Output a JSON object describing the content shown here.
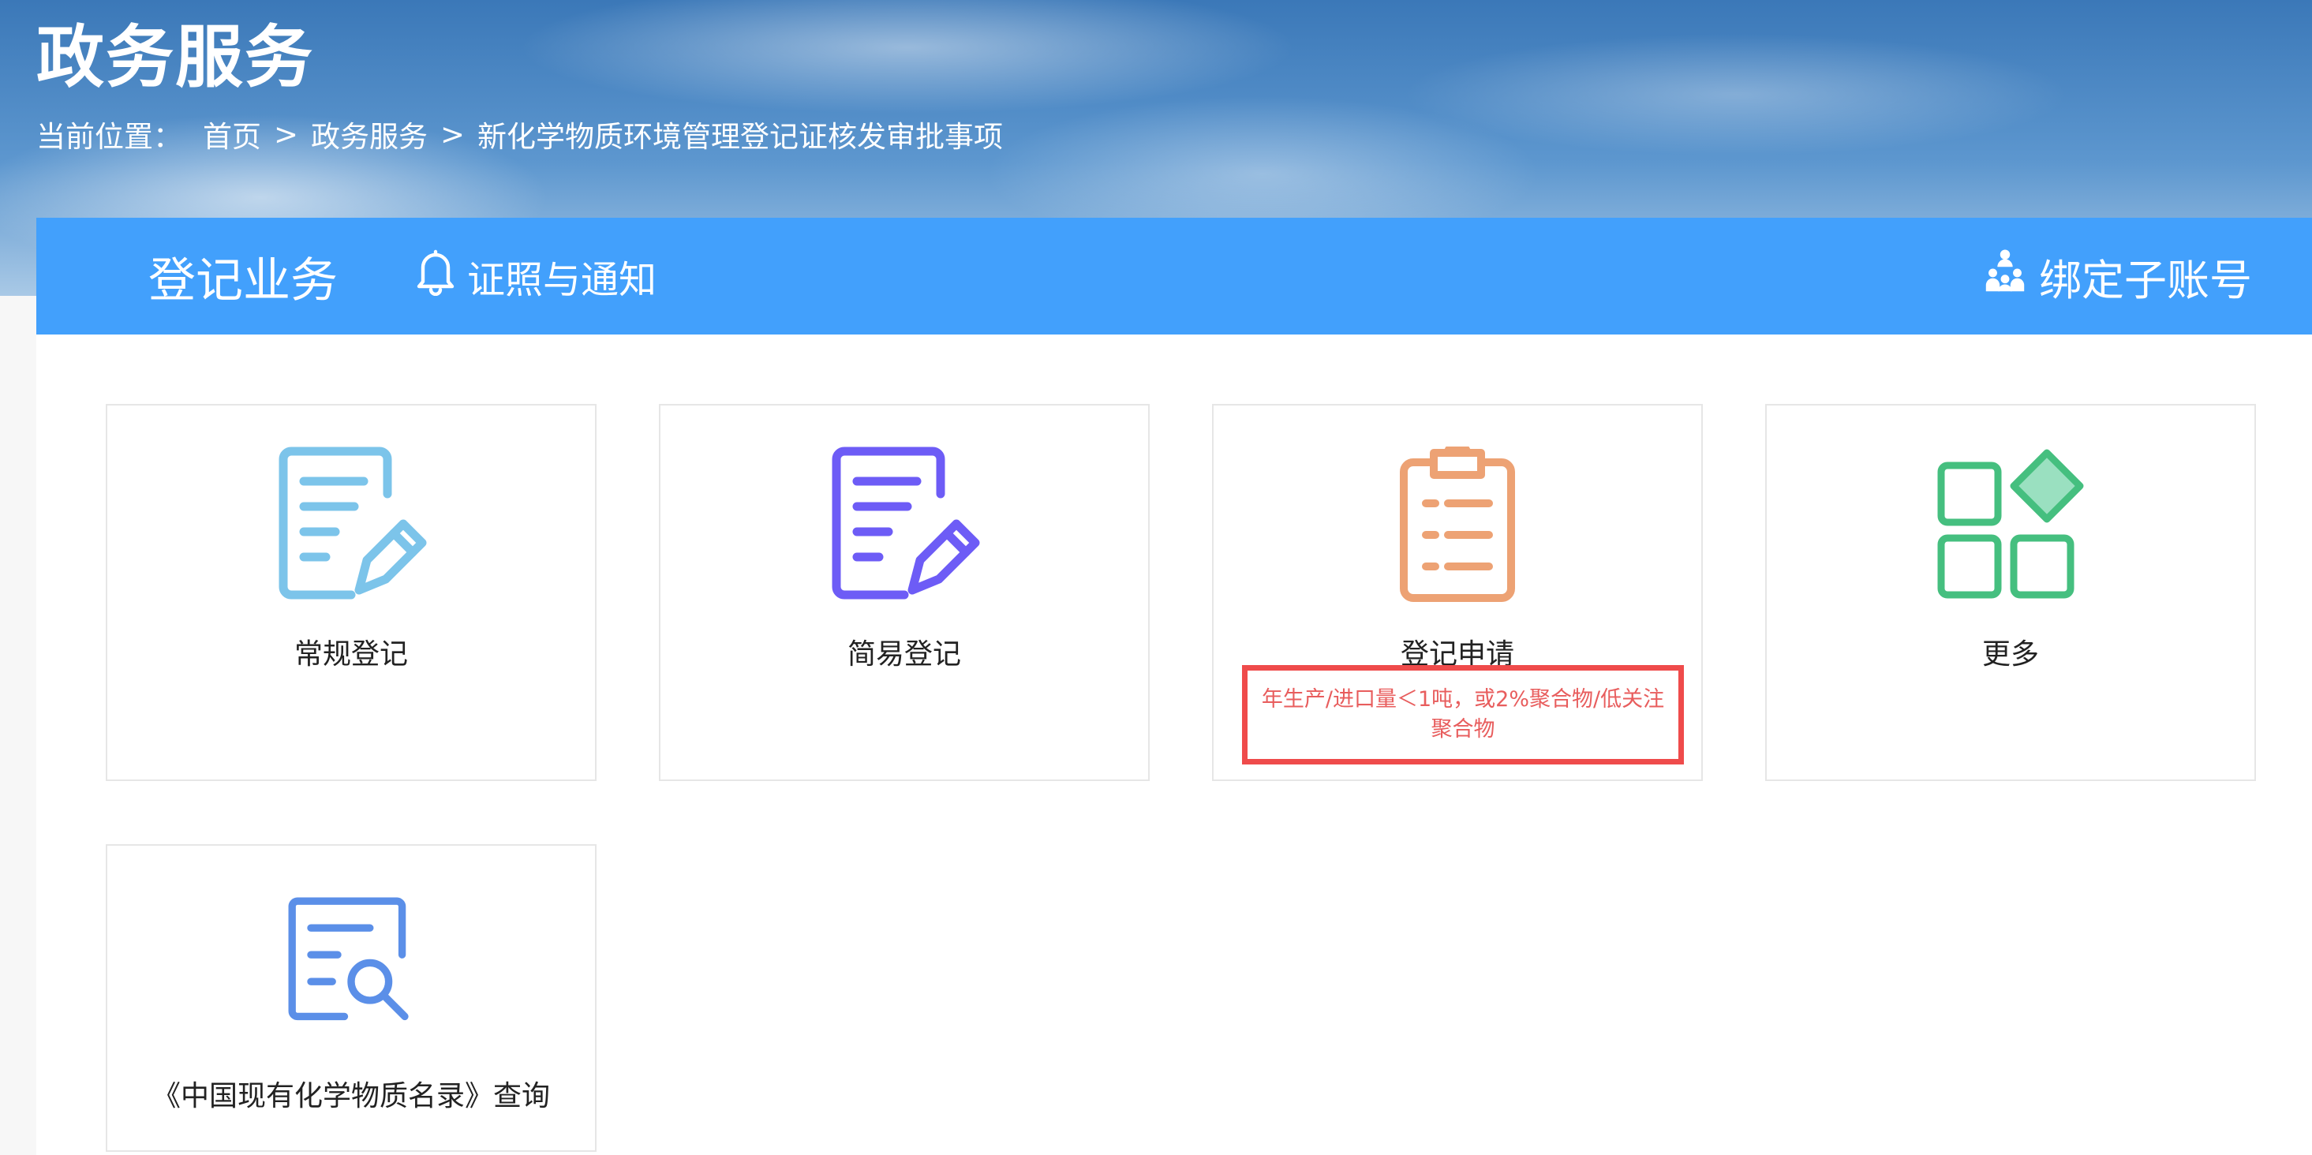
{
  "header": {
    "title": "政务服务",
    "breadcrumb": {
      "prefix": "当前位置：",
      "items": [
        "首页",
        "政务服务",
        "新化学物质环境管理登记证核发审批事项"
      ],
      "separator": ">"
    }
  },
  "navbar": {
    "tabs": [
      {
        "label": "登记业务",
        "icon": null
      },
      {
        "label": "证照与通知",
        "icon": "bell-icon"
      }
    ],
    "bind_account": {
      "label": "绑定子账号",
      "icon": "org-chart-icon"
    },
    "background_color": "#42a0fc"
  },
  "cards": [
    {
      "label": "常规登记",
      "icon": "document-edit-icon",
      "icon_color": "#7cc4ea"
    },
    {
      "label": "简易登记",
      "icon": "document-edit-icon",
      "icon_color": "#6d5cf6"
    },
    {
      "label": "登记申请",
      "icon": "clipboard-list-icon",
      "icon_color": "#eda274",
      "note": "年生产/进口量＜1吨，或2%聚合物/低关注聚合物",
      "note_color": "#ef4b4b"
    },
    {
      "label": "更多",
      "icon": "apps-grid-icon",
      "icon_color": "#45bf7f"
    },
    {
      "label": "《中国现有化学物质名录》查询",
      "icon": "document-search-icon",
      "icon_color": "#5b8fe8"
    }
  ]
}
